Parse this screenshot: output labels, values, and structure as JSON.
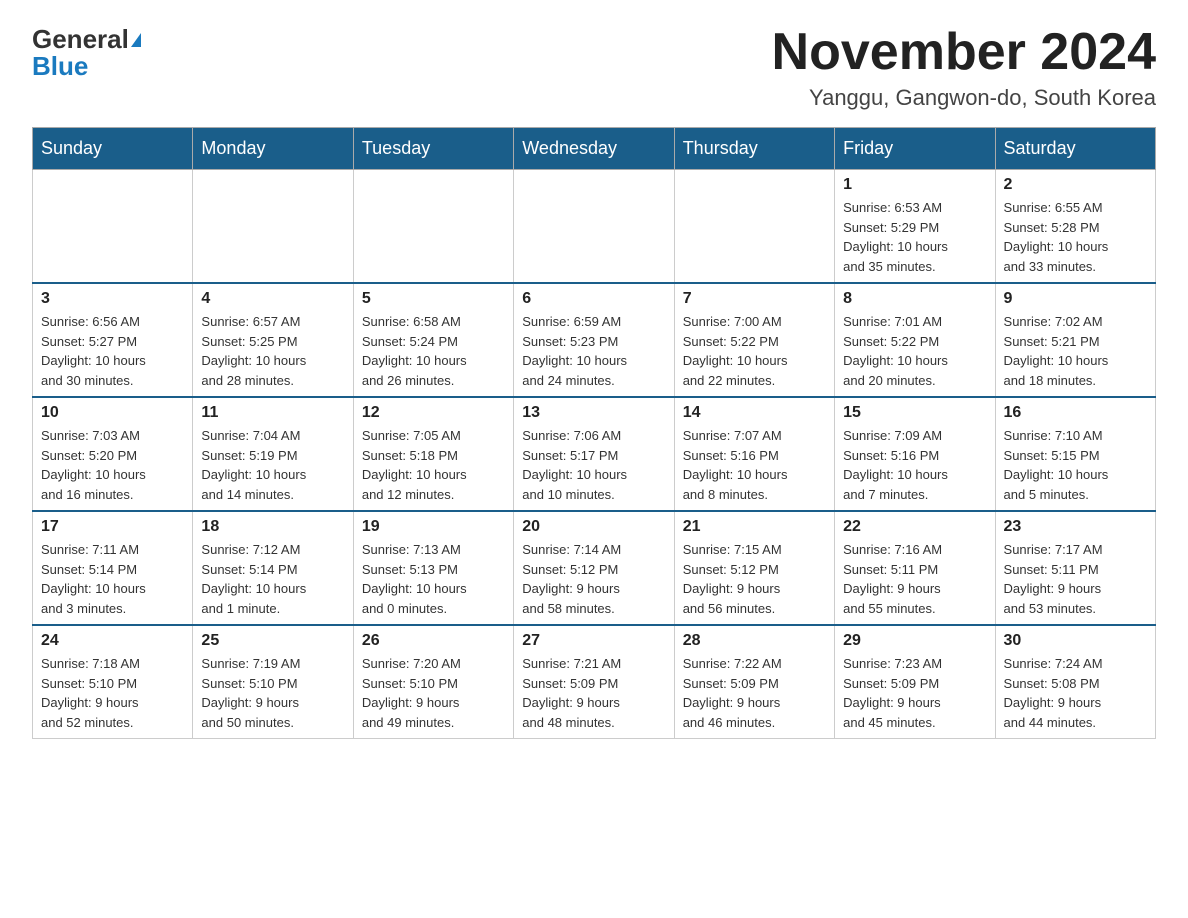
{
  "header": {
    "logo_general": "General",
    "logo_blue": "Blue",
    "month_title": "November 2024",
    "location": "Yanggu, Gangwon-do, South Korea"
  },
  "weekdays": [
    "Sunday",
    "Monday",
    "Tuesday",
    "Wednesday",
    "Thursday",
    "Friday",
    "Saturday"
  ],
  "weeks": [
    [
      {
        "day": "",
        "info": ""
      },
      {
        "day": "",
        "info": ""
      },
      {
        "day": "",
        "info": ""
      },
      {
        "day": "",
        "info": ""
      },
      {
        "day": "",
        "info": ""
      },
      {
        "day": "1",
        "info": "Sunrise: 6:53 AM\nSunset: 5:29 PM\nDaylight: 10 hours\nand 35 minutes."
      },
      {
        "day": "2",
        "info": "Sunrise: 6:55 AM\nSunset: 5:28 PM\nDaylight: 10 hours\nand 33 minutes."
      }
    ],
    [
      {
        "day": "3",
        "info": "Sunrise: 6:56 AM\nSunset: 5:27 PM\nDaylight: 10 hours\nand 30 minutes."
      },
      {
        "day": "4",
        "info": "Sunrise: 6:57 AM\nSunset: 5:25 PM\nDaylight: 10 hours\nand 28 minutes."
      },
      {
        "day": "5",
        "info": "Sunrise: 6:58 AM\nSunset: 5:24 PM\nDaylight: 10 hours\nand 26 minutes."
      },
      {
        "day": "6",
        "info": "Sunrise: 6:59 AM\nSunset: 5:23 PM\nDaylight: 10 hours\nand 24 minutes."
      },
      {
        "day": "7",
        "info": "Sunrise: 7:00 AM\nSunset: 5:22 PM\nDaylight: 10 hours\nand 22 minutes."
      },
      {
        "day": "8",
        "info": "Sunrise: 7:01 AM\nSunset: 5:22 PM\nDaylight: 10 hours\nand 20 minutes."
      },
      {
        "day": "9",
        "info": "Sunrise: 7:02 AM\nSunset: 5:21 PM\nDaylight: 10 hours\nand 18 minutes."
      }
    ],
    [
      {
        "day": "10",
        "info": "Sunrise: 7:03 AM\nSunset: 5:20 PM\nDaylight: 10 hours\nand 16 minutes."
      },
      {
        "day": "11",
        "info": "Sunrise: 7:04 AM\nSunset: 5:19 PM\nDaylight: 10 hours\nand 14 minutes."
      },
      {
        "day": "12",
        "info": "Sunrise: 7:05 AM\nSunset: 5:18 PM\nDaylight: 10 hours\nand 12 minutes."
      },
      {
        "day": "13",
        "info": "Sunrise: 7:06 AM\nSunset: 5:17 PM\nDaylight: 10 hours\nand 10 minutes."
      },
      {
        "day": "14",
        "info": "Sunrise: 7:07 AM\nSunset: 5:16 PM\nDaylight: 10 hours\nand 8 minutes."
      },
      {
        "day": "15",
        "info": "Sunrise: 7:09 AM\nSunset: 5:16 PM\nDaylight: 10 hours\nand 7 minutes."
      },
      {
        "day": "16",
        "info": "Sunrise: 7:10 AM\nSunset: 5:15 PM\nDaylight: 10 hours\nand 5 minutes."
      }
    ],
    [
      {
        "day": "17",
        "info": "Sunrise: 7:11 AM\nSunset: 5:14 PM\nDaylight: 10 hours\nand 3 minutes."
      },
      {
        "day": "18",
        "info": "Sunrise: 7:12 AM\nSunset: 5:14 PM\nDaylight: 10 hours\nand 1 minute."
      },
      {
        "day": "19",
        "info": "Sunrise: 7:13 AM\nSunset: 5:13 PM\nDaylight: 10 hours\nand 0 minutes."
      },
      {
        "day": "20",
        "info": "Sunrise: 7:14 AM\nSunset: 5:12 PM\nDaylight: 9 hours\nand 58 minutes."
      },
      {
        "day": "21",
        "info": "Sunrise: 7:15 AM\nSunset: 5:12 PM\nDaylight: 9 hours\nand 56 minutes."
      },
      {
        "day": "22",
        "info": "Sunrise: 7:16 AM\nSunset: 5:11 PM\nDaylight: 9 hours\nand 55 minutes."
      },
      {
        "day": "23",
        "info": "Sunrise: 7:17 AM\nSunset: 5:11 PM\nDaylight: 9 hours\nand 53 minutes."
      }
    ],
    [
      {
        "day": "24",
        "info": "Sunrise: 7:18 AM\nSunset: 5:10 PM\nDaylight: 9 hours\nand 52 minutes."
      },
      {
        "day": "25",
        "info": "Sunrise: 7:19 AM\nSunset: 5:10 PM\nDaylight: 9 hours\nand 50 minutes."
      },
      {
        "day": "26",
        "info": "Sunrise: 7:20 AM\nSunset: 5:10 PM\nDaylight: 9 hours\nand 49 minutes."
      },
      {
        "day": "27",
        "info": "Sunrise: 7:21 AM\nSunset: 5:09 PM\nDaylight: 9 hours\nand 48 minutes."
      },
      {
        "day": "28",
        "info": "Sunrise: 7:22 AM\nSunset: 5:09 PM\nDaylight: 9 hours\nand 46 minutes."
      },
      {
        "day": "29",
        "info": "Sunrise: 7:23 AM\nSunset: 5:09 PM\nDaylight: 9 hours\nand 45 minutes."
      },
      {
        "day": "30",
        "info": "Sunrise: 7:24 AM\nSunset: 5:08 PM\nDaylight: 9 hours\nand 44 minutes."
      }
    ]
  ]
}
